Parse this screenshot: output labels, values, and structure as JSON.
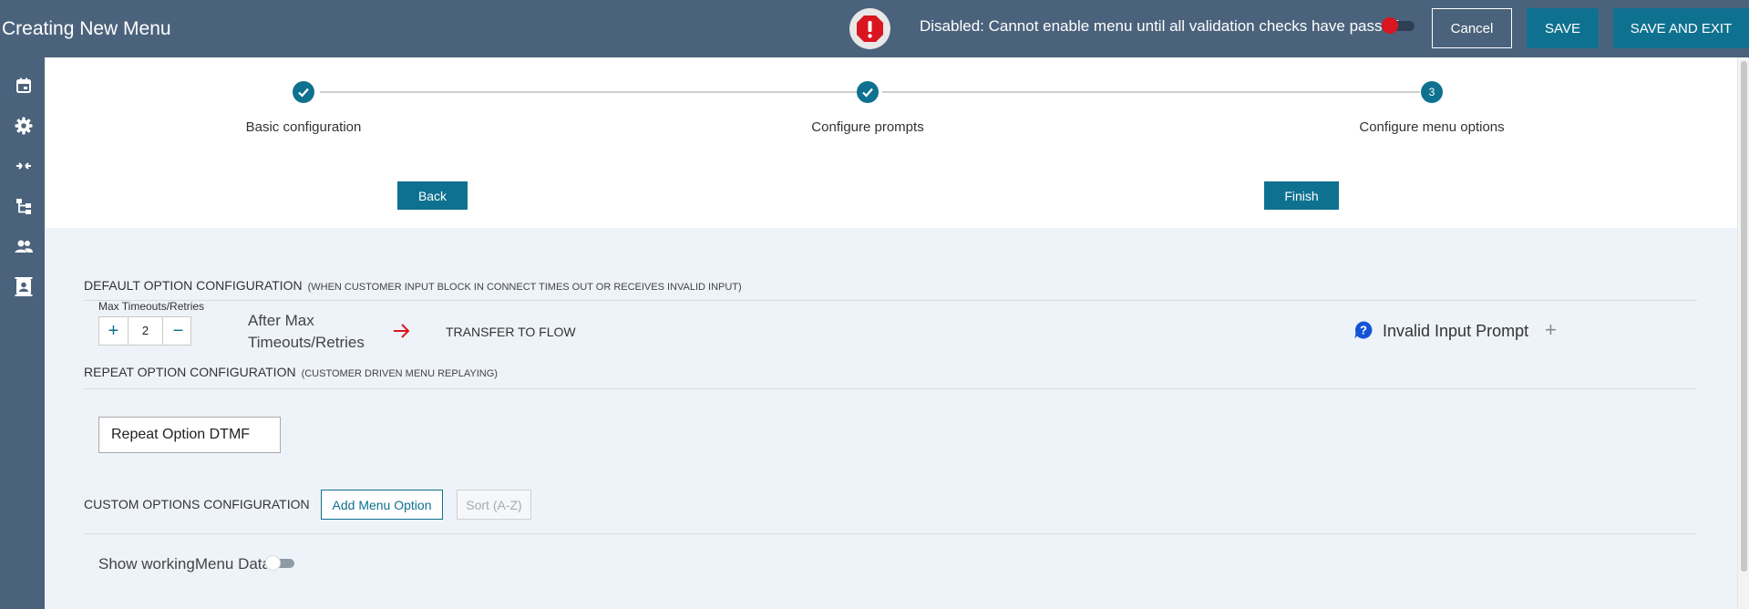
{
  "header": {
    "title": "Creating New Menu",
    "status_text": "Disabled: Cannot enable menu until all validation checks have passed",
    "cancel_label": "Cancel",
    "save_label": "SAVE",
    "save_exit_label": "SAVE AND EXIT",
    "alert_icon": "alert-octagon-icon",
    "enable_toggle_on": false
  },
  "sidebar": {
    "items": [
      {
        "icon": "calendar-icon"
      },
      {
        "icon": "gear-icon"
      },
      {
        "icon": "merge-arrows-icon"
      },
      {
        "icon": "hierarchy-icon"
      },
      {
        "icon": "people-icon"
      },
      {
        "icon": "contact-card-icon"
      }
    ]
  },
  "stepper": {
    "steps": [
      {
        "label": "Basic configuration",
        "state": "complete",
        "number": "1"
      },
      {
        "label": "Configure prompts",
        "state": "complete",
        "number": "2"
      },
      {
        "label": "Configure menu options",
        "state": "current",
        "number": "3"
      }
    ],
    "back_label": "Back",
    "finish_label": "Finish"
  },
  "default_option": {
    "title": "DEFAULT OPTION CONFIGURATION",
    "subtitle": "(WHEN CUSTOMER INPUT BLOCK IN CONNECT TIMES OUT OR RECEIVES INVALID INPUT)",
    "max_label": "Max Timeouts/Retries",
    "max_value": "2",
    "after_max_label": "After Max Timeouts/Retries",
    "action_label": "TRANSFER TO FLOW",
    "invalid_prompt_label": "Invalid Input Prompt"
  },
  "repeat_option": {
    "title": "REPEAT OPTION CONFIGURATION",
    "subtitle": "(CUSTOMER DRIVEN MENU REPLAYING)",
    "button_label": "Repeat Option DTMF"
  },
  "custom_options": {
    "title": "CUSTOM OPTIONS CONFIGURATION",
    "add_label": "Add Menu Option",
    "sort_label": "Sort (A-Z)"
  },
  "debug": {
    "show_label": "Show workingMenu Data",
    "toggle_on": false
  },
  "colors": {
    "header_bg": "#4b627c",
    "accent": "#0f7190",
    "error": "#d9151f",
    "content_bg": "#eef3f9"
  }
}
